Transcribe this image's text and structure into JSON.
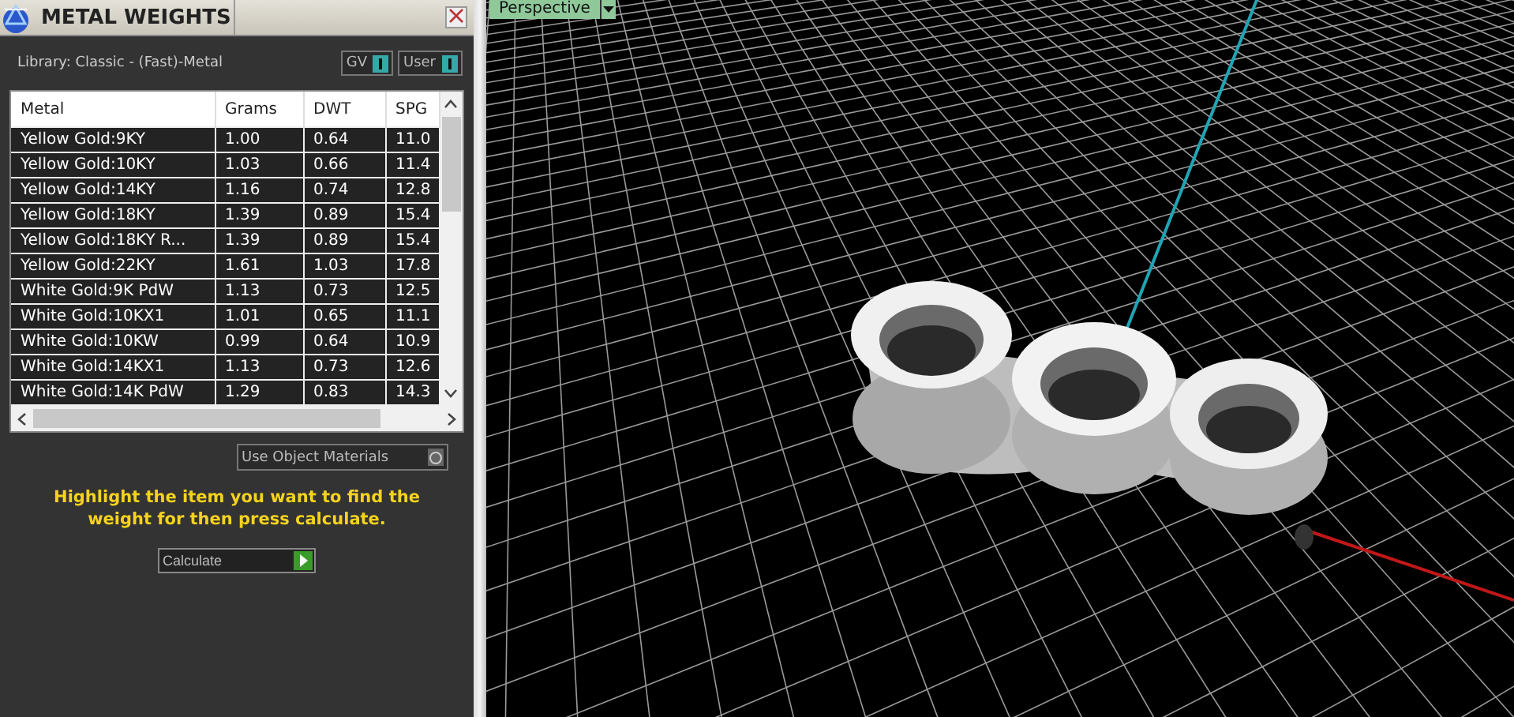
{
  "panel": {
    "title": "METAL WEIGHTS",
    "library": "Library: Classic - (Fast)-Metal",
    "toggles": [
      {
        "label": "GV",
        "on": true
      },
      {
        "label": "User",
        "on": true
      }
    ]
  },
  "table": {
    "columns": [
      "Metal",
      "Grams",
      "DWT",
      "SPG"
    ],
    "rows": [
      {
        "cells": [
          "Yellow Gold:9KY",
          "1.00",
          "0.64",
          "11.0"
        ]
      },
      {
        "cells": [
          "Yellow Gold:10KY",
          "1.03",
          "0.66",
          "11.4"
        ]
      },
      {
        "cells": [
          "Yellow Gold:14KY",
          "1.16",
          "0.74",
          "12.8"
        ]
      },
      {
        "cells": [
          "Yellow Gold:18KY",
          "1.39",
          "0.89",
          "15.4"
        ]
      },
      {
        "cells": [
          "Yellow Gold:18KY R...",
          "1.39",
          "0.89",
          "15.4"
        ]
      },
      {
        "cells": [
          "Yellow Gold:22KY",
          "1.61",
          "1.03",
          "17.8"
        ]
      },
      {
        "cells": [
          "White Gold:9K PdW",
          "1.13",
          "0.73",
          "12.5"
        ]
      },
      {
        "cells": [
          "White Gold:10KX1",
          "1.01",
          "0.65",
          "11.1"
        ]
      },
      {
        "cells": [
          "White Gold:10KW",
          "0.99",
          "0.64",
          "10.9"
        ]
      },
      {
        "cells": [
          "White Gold:14KX1",
          "1.13",
          "0.73",
          "12.6"
        ]
      },
      {
        "cells": [
          "White Gold:14K PdW",
          "1.29",
          "0.83",
          "14.3"
        ]
      }
    ]
  },
  "use_object_materials": {
    "label": "Use Object Materials",
    "on": false
  },
  "hint": "Highlight the item you want to find the weight for then press calculate.",
  "calculate_button": "Calculate",
  "viewport": {
    "view_menu": "Perspective"
  }
}
